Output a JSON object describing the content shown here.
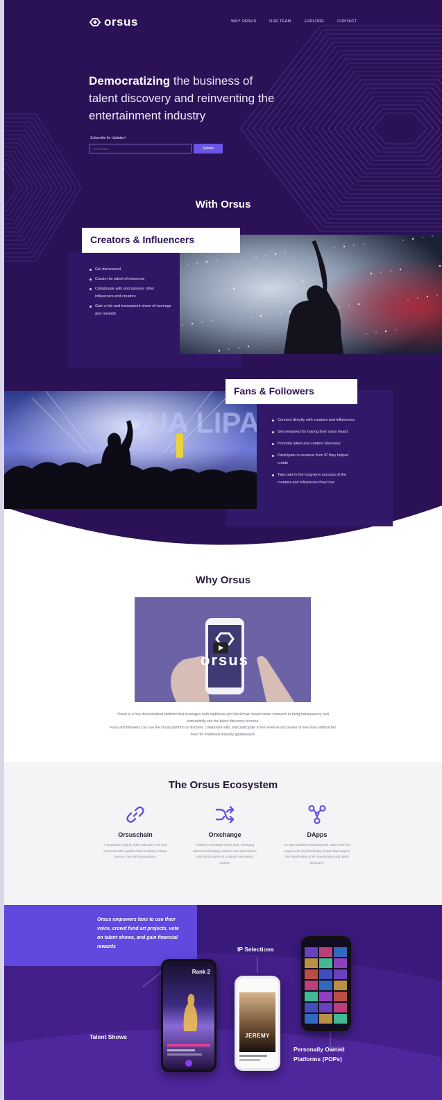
{
  "brand": {
    "name": "orsus"
  },
  "nav": {
    "items": [
      "WHY ORSUS",
      "OUR TEAM",
      "EXPLORE",
      "CONTACT"
    ]
  },
  "hero": {
    "headline_bold": "Democratizing",
    "headline_rest": " the business of talent discovery and reinventing the entertainment industry",
    "subscribe_label": "Subscribe for Updates!",
    "email_placeholder": "Your Email",
    "submit_label": "Submit"
  },
  "with_orsus": {
    "title": "With Orsus",
    "creators": {
      "title": "Creators & Influencers",
      "items": [
        "Get discovered",
        "Curate the talent of tomorrow",
        "Collaborate with and sponsor other influencers and creators",
        "Gain a fair and transparent share of earnings and rewards"
      ]
    },
    "fans": {
      "title": "Fans & Followers",
      "items": [
        "Connect directly with creators and influencers",
        "Get rewarded for having their voice heard",
        "Promote talent and content discovery",
        "Participate in revenue from IP they helped create",
        "Take part in the long-term success of the creators and influencers they love"
      ]
    }
  },
  "why": {
    "title": "Why Orsus",
    "video_logo": "orsus",
    "desc_1": "Orsus is a free decentralized platform that leverages both traditional and blockchain based smart contracts to bring transparency and immutability into the talent discovery process.",
    "desc_2": "Fans and followers can use the Orsus platform to discover, collaborate with, and participate in the revenue successes of new stars without the need for traditional industry gatekeepers."
  },
  "ecosystem": {
    "title": "The Orsus Ecosystem",
    "items": [
      {
        "name": "Orsuschain",
        "icon": "chain-link-icon",
        "desc": "A proprietary hybrid chain that uses PoS and connects with a public chain enabling instant, secure, low cost transactions."
      },
      {
        "name": "Orxchange",
        "icon": "shuffle-icon",
        "desc": "A built-in exchange where fans, emerging talents and leading creators can trade tokens and fund projects in a vibrant secondary market."
      },
      {
        "name": "DApps",
        "icon": "network-nodes-icon",
        "desc": "An open platform featuring both native and free plug-ins for any third party DApps that support the tokenization of IP monetization and talent discovery."
      }
    ]
  },
  "showcase": {
    "quote": "Orsus empowers fans to use their voice, crowd fund art projects, vote on talent shows, and gain financial rewards",
    "label_ip": "IP Selections",
    "label_talent": "Talent Shows",
    "label_pops": "Personally Owned Platforms (POPs)",
    "phone_rank": "Rank 2",
    "phone_name": "JEREMY"
  },
  "colors": {
    "hero_bg": "#2b1257",
    "accent": "#6b56e4",
    "icon_purple": "#6a4fd8"
  }
}
